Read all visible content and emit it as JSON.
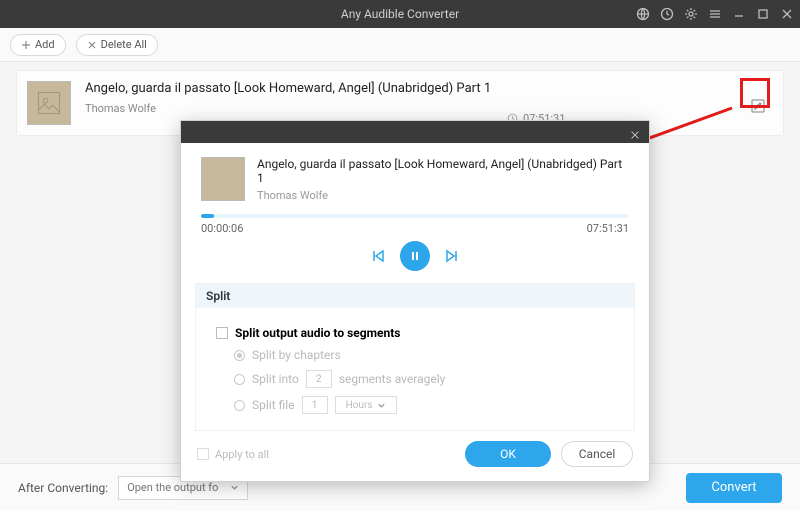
{
  "app": {
    "title": "Any Audible Converter"
  },
  "toolbar": {
    "add": "Add",
    "delete_all": "Delete All"
  },
  "item": {
    "title": "Angelo, guarda il passato [Look Homeward, Angel] (Unabridged) Part 1",
    "author": "Thomas Wolfe",
    "duration": "07:51:31"
  },
  "modal": {
    "title": "Angelo, guarda il passato [Look Homeward, Angel] (Unabridged) Part 1",
    "author": "Thomas Wolfe",
    "time_elapsed": "00:00:06",
    "time_total": "07:51:31",
    "split": {
      "heading": "Split",
      "enable_label": "Split output audio to segments",
      "by_chapters": "Split by chapters",
      "into_prefix": "Split into",
      "into_value": "2",
      "into_suffix": "segments averagely",
      "file_prefix": "Split file",
      "file_value": "1",
      "file_unit": "Hours"
    },
    "apply_all": "Apply to all",
    "ok": "OK",
    "cancel": "Cancel"
  },
  "footer": {
    "label": "After Converting:",
    "option": "Open the output fo",
    "convert": "Convert"
  }
}
